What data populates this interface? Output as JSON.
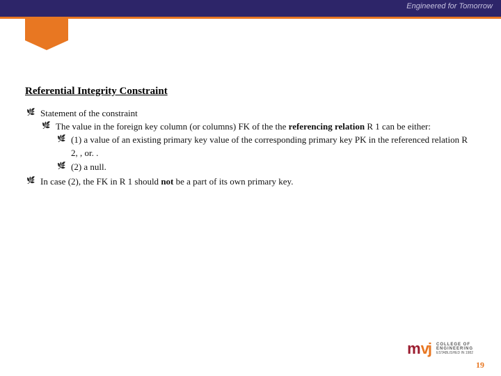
{
  "header": {
    "tagline": "Engineered for Tomorrow"
  },
  "slide": {
    "title": "Referential Integrity Constraint",
    "bullets": {
      "b1": "Statement of the constraint",
      "b1_1_a": "The value in the foreign key column (or columns) FK of the the ",
      "b1_1_bold": "referencing relation",
      "b1_1_b": " R 1 can be either:",
      "b1_1_1": "(1) a value of an existing primary key value of the corresponding primary key PK in the referenced relation R 2, , or. .",
      "b1_1_2": "(2) a null.",
      "b2_a": "In case (2), the FK in R 1 should ",
      "b2_bold": "not",
      "b2_b": " be a part of its own primary key."
    }
  },
  "footer": {
    "logo_m": "m",
    "logo_vj": "vj",
    "logo_line1": "COLLEGE OF",
    "logo_line2": "ENGINEERING",
    "logo_line3": "ESTABLISHED IN 1982",
    "page": "19"
  }
}
